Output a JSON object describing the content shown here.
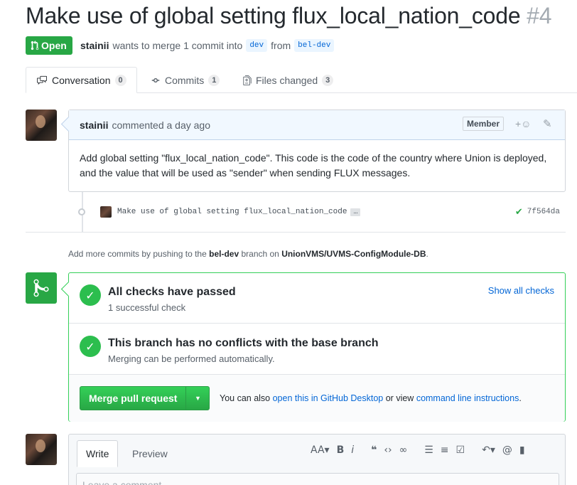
{
  "header": {
    "title": "Make use of global setting flux_local_nation_code",
    "number": "#4",
    "state": "Open",
    "author": "stainii",
    "meta_text": "wants to merge 1 commit into",
    "base_branch": "dev",
    "from_text": "from",
    "head_branch": "bel-dev"
  },
  "tabs": [
    {
      "label": "Conversation",
      "count": "0"
    },
    {
      "label": "Commits",
      "count": "1"
    },
    {
      "label": "Files changed",
      "count": "3"
    }
  ],
  "comment": {
    "author": "stainii",
    "action": "commented a day ago",
    "badge": "Member",
    "body": "Add global setting \"flux_local_nation_code\". This code is the code of the country where Union is deployed, and the value that will be used as \"sender\" when sending FLUX messages."
  },
  "commit": {
    "message": "Make use of global setting flux_local_nation_code",
    "ellipsis": "…",
    "sha": "7f564da"
  },
  "push_hint": {
    "prefix": "Add more commits by pushing to the",
    "branch": "bel-dev",
    "middle": "branch on",
    "repo": "UnionVMS/UVMS-ConfigModule-DB",
    "suffix": "."
  },
  "merge": {
    "checks_title": "All checks have passed",
    "checks_sub": "1 successful check",
    "show_checks": "Show all checks",
    "conflict_title": "This branch has no conflicts with the base branch",
    "conflict_sub": "Merging can be performed automatically.",
    "button": "Merge pull request",
    "alt_prefix": "You can also",
    "alt_link1": "open this in GitHub Desktop",
    "alt_middle": "or view",
    "alt_link2": "command line instructions",
    "alt_suffix": "."
  },
  "editor": {
    "write_tab": "Write",
    "preview_tab": "Preview",
    "placeholder": "Leave a comment"
  },
  "colors": {
    "green": "#28a745",
    "link": "#0366d6",
    "header_bg": "#f1f8ff"
  }
}
